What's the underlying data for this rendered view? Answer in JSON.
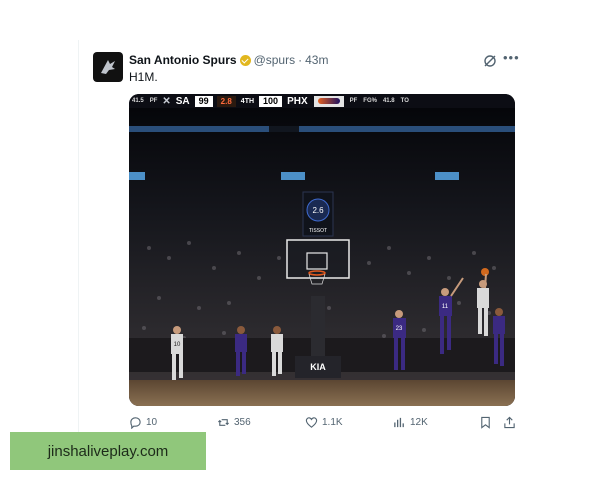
{
  "tweet": {
    "display_name": "San Antonio Spurs",
    "handle": "@spurs",
    "separator": "·",
    "time": "43m",
    "text": "H1M."
  },
  "scorebug": {
    "left_stat": "41.5",
    "left_stat_label": "FG%",
    "left_fouls": "PF",
    "home_team": "SA",
    "home_score": "99",
    "clock": "2.8",
    "quarter": "4TH",
    "away_score": "100",
    "away_team": "PHX",
    "right_fouls": "PF",
    "right_fg_label": "FG%",
    "right_fg": "41.8",
    "right_to_label": "TO"
  },
  "arena": {
    "shot_clock": "2.6",
    "shot_clock_brand": "TISSOT",
    "sponsor_floor": "KIA",
    "jersey_numbers": [
      "10",
      "23",
      "11"
    ]
  },
  "actions": {
    "replies": "10",
    "reposts": "356",
    "likes": "1.1K",
    "views": "12K"
  },
  "watermark": {
    "text": "jinshaliveplay.com"
  },
  "colors": {
    "text_primary": "#0f1419",
    "text_secondary": "#536471",
    "verified_gold": "#e2b71e",
    "watermark_bg": "#90c77b",
    "suns_purple": "#3b2a82",
    "spurs_white": "#d9d9d9"
  },
  "icons": {
    "avatar": "spurs-logo",
    "verified": "verified-badge-icon",
    "grok": "grok-icon",
    "more": "more-icon",
    "reply": "reply-icon",
    "repost": "repost-icon",
    "like": "heart-icon",
    "views": "views-icon",
    "bookmark": "bookmark-icon",
    "share": "share-icon"
  }
}
